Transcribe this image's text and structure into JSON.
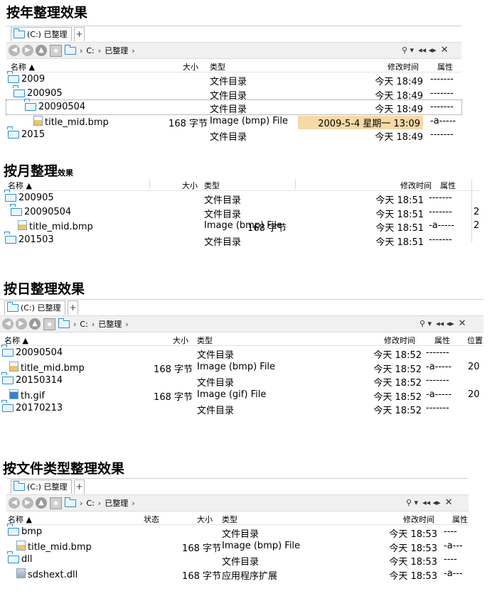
{
  "sections": {
    "year_title": "按年整理效果",
    "month_title": "按月整理",
    "month_title_small": "效果",
    "day_title": "按日整理效果",
    "type_title": "按文件类型整理效果"
  },
  "tab_label": "(C:) 已整理",
  "tab_plus": "+",
  "address": {
    "drive": "C:",
    "folder": "已整理",
    "sep": "›"
  },
  "tools": {
    "search": "⚲ ▾",
    "arrows": "◂◂ ◂▸",
    "close": "✕"
  },
  "headers": {
    "name": "名称",
    "size": "大小",
    "type": "类型",
    "modified": "修改时间",
    "attr": "属性",
    "location": "位置",
    "status": "状态"
  },
  "year_rows": [
    {
      "name": "2009",
      "size": "",
      "type": "文件目录",
      "modified": "今天 18:49",
      "attr": "-------"
    },
    {
      "name": "200905",
      "size": "",
      "type": "文件目录",
      "modified": "今天 18:49",
      "attr": "-------"
    },
    {
      "name": "20090504",
      "size": "",
      "type": "文件目录",
      "modified": "今天 18:49",
      "attr": "-------"
    },
    {
      "name": "title_mid.bmp",
      "size": "168 字节",
      "type": "Image (bmp) File",
      "modified": "2009-5-4 星期一 13:09",
      "attr": "-a-----"
    },
    {
      "name": "2015",
      "size": "",
      "type": "文件目录",
      "modified": "今天 18:49",
      "attr": "-------"
    }
  ],
  "month_rows": [
    {
      "name": "200905",
      "size": "",
      "type": "文件目录",
      "modified": "今天 18:51",
      "attr": "-------",
      "extra": ""
    },
    {
      "name": "20090504",
      "size": "",
      "type": "文件目录",
      "modified": "今天 18:51",
      "attr": "-------",
      "extra": "2"
    },
    {
      "name": "title_mid.bmp",
      "size": "168 字节",
      "type": "Image (bmp) File",
      "modified": "今天 18:51",
      "attr": "-a-----",
      "extra": "2"
    },
    {
      "name": "201503",
      "size": "",
      "type": "文件目录",
      "modified": "今天 18:51",
      "attr": "-------",
      "extra": ""
    }
  ],
  "day_rows": [
    {
      "name": "20090504",
      "size": "",
      "type": "文件目录",
      "modified": "今天 18:52",
      "attr": "-------",
      "location": ""
    },
    {
      "name": "title_mid.bmp",
      "size": "168 字节",
      "type": "Image (bmp) File",
      "modified": "今天 18:52",
      "attr": "-a-----",
      "location": "20"
    },
    {
      "name": "20150314",
      "size": "",
      "type": "文件目录",
      "modified": "今天 18:52",
      "attr": "-------",
      "location": ""
    },
    {
      "name": "th.gif",
      "size": "168 字节",
      "type": "Image (gif) File",
      "modified": "今天 18:52",
      "attr": "-a-----",
      "location": "20"
    },
    {
      "name": "20170213",
      "size": "",
      "type": "文件目录",
      "modified": "今天 18:52",
      "attr": "-------",
      "location": ""
    }
  ],
  "type_rows": [
    {
      "name": "bmp",
      "size": "",
      "type": "文件目录",
      "modified": "今天 18:53",
      "attr": "----"
    },
    {
      "name": "title_mid.bmp",
      "size": "168 字节",
      "type": "Image (bmp) File",
      "modified": "今天 18:53",
      "attr": "-a---"
    },
    {
      "name": "dll",
      "size": "",
      "type": "文件目录",
      "modified": "今天 18:53",
      "attr": "----"
    },
    {
      "name": "sdshext.dll",
      "size": "168 字节",
      "type": "应用程序扩展",
      "modified": "今天 18:53",
      "attr": "-a---"
    }
  ]
}
